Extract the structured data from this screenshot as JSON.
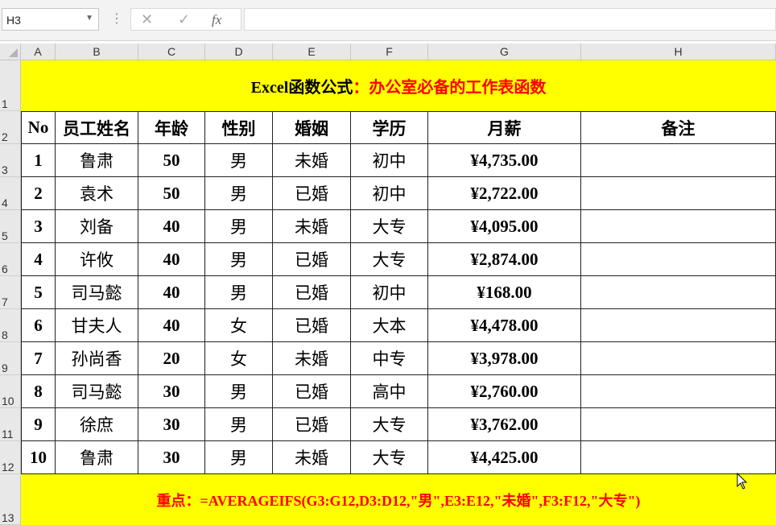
{
  "formula_bar": {
    "name_box": "H3",
    "cancel_icon": "✕",
    "enter_icon": "✓",
    "fx_label": "fx",
    "formula": ""
  },
  "columns": [
    "A",
    "B",
    "C",
    "D",
    "E",
    "F",
    "G",
    "H"
  ],
  "rows": [
    "1",
    "2",
    "3",
    "4",
    "5",
    "6",
    "7",
    "8",
    "9",
    "10",
    "11",
    "12",
    "13"
  ],
  "title": {
    "black_part": "Excel函数公式",
    "red_part": "：办公室必备的工作表函数"
  },
  "table": {
    "headers": [
      "No",
      "员工姓名",
      "年龄",
      "性别",
      "婚姻",
      "学历",
      "月薪",
      "备注"
    ],
    "data": [
      [
        "1",
        "鲁肃",
        "50",
        "男",
        "未婚",
        "初中",
        "¥4,735.00",
        ""
      ],
      [
        "2",
        "袁术",
        "50",
        "男",
        "已婚",
        "初中",
        "¥2,722.00",
        ""
      ],
      [
        "3",
        "刘备",
        "40",
        "男",
        "未婚",
        "大专",
        "¥4,095.00",
        ""
      ],
      [
        "4",
        "许攸",
        "40",
        "男",
        "已婚",
        "大专",
        "¥2,874.00",
        ""
      ],
      [
        "5",
        "司马懿",
        "40",
        "男",
        "已婚",
        "初中",
        "¥168.00",
        ""
      ],
      [
        "6",
        "甘夫人",
        "40",
        "女",
        "已婚",
        "大本",
        "¥4,478.00",
        ""
      ],
      [
        "7",
        "孙尚香",
        "20",
        "女",
        "未婚",
        "中专",
        "¥3,978.00",
        ""
      ],
      [
        "8",
        "司马懿",
        "30",
        "男",
        "已婚",
        "高中",
        "¥2,760.00",
        ""
      ],
      [
        "9",
        "徐庶",
        "30",
        "男",
        "已婚",
        "大专",
        "¥3,762.00",
        ""
      ],
      [
        "10",
        "鲁肃",
        "30",
        "男",
        "未婚",
        "大专",
        "¥4,425.00",
        ""
      ]
    ]
  },
  "footer": {
    "label": "重点：",
    "formula": "=AVERAGEIFS(G3:G12,D3:D12,\"男\",E3:E12,\"未婚\",F3:F12,\"大专\")"
  },
  "colors": {
    "band": "#ffff00",
    "red_text": "#ff0000",
    "header_bg": "#e8e8e8",
    "selection": "#217346"
  }
}
